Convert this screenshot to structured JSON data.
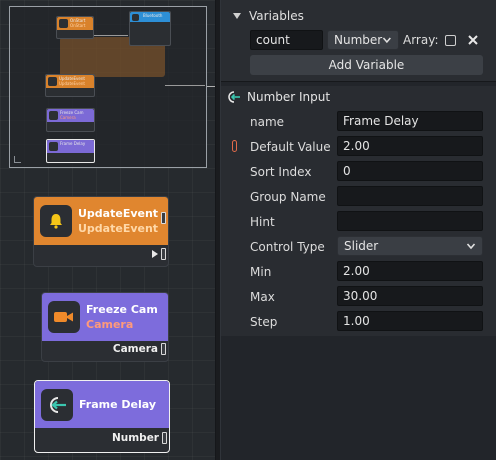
{
  "canvas": {
    "minimap": {
      "nodes": [
        {
          "title": "OnStart",
          "sub": "OnStart",
          "color": "#d9822b"
        },
        {
          "title": "Bluetooth",
          "sub": "",
          "color": "#2d8fd6"
        },
        {
          "title": "UpdateEvent",
          "sub": "UpdateEvent",
          "color": "#d9822b"
        },
        {
          "title": "Freeze Cam",
          "sub": "Camera",
          "color": "#7c6ad6"
        },
        {
          "title": "Frame Delay",
          "sub": "",
          "color": "#7c6ad6"
        }
      ]
    },
    "nodes": [
      {
        "title": "UpdateEvent",
        "subtitle": "UpdateEvent",
        "color": "#e0862f",
        "subcolor": "#ffd8a8",
        "icon": "bell-icon"
      },
      {
        "title": "Freeze Cam",
        "subtitle": "Camera",
        "color": "#7d6cdc",
        "subcolor": "#ff9a7a",
        "icon": "camera-icon",
        "output": "Camera"
      },
      {
        "title": "Frame Delay",
        "subtitle": "",
        "color": "#7d6cdc",
        "icon": "input-arrow-icon",
        "output": "Number"
      }
    ]
  },
  "variables": {
    "title": "Variables",
    "name_value": "count",
    "type_value": "Number",
    "array_label": "Array:",
    "add_button": "Add Variable"
  },
  "properties": {
    "header": "Number Input",
    "rows": [
      {
        "label": "name",
        "value": "Frame Delay"
      },
      {
        "label": "Default Value",
        "value": "2.00"
      },
      {
        "label": "Sort Index",
        "value": "0"
      },
      {
        "label": "Group Name",
        "value": ""
      },
      {
        "label": "Hint",
        "value": ""
      },
      {
        "label": "Control Type",
        "value": "Slider"
      },
      {
        "label": "Min",
        "value": "2.00"
      },
      {
        "label": "Max",
        "value": "30.00"
      },
      {
        "label": "Step",
        "value": "1.00"
      }
    ]
  }
}
